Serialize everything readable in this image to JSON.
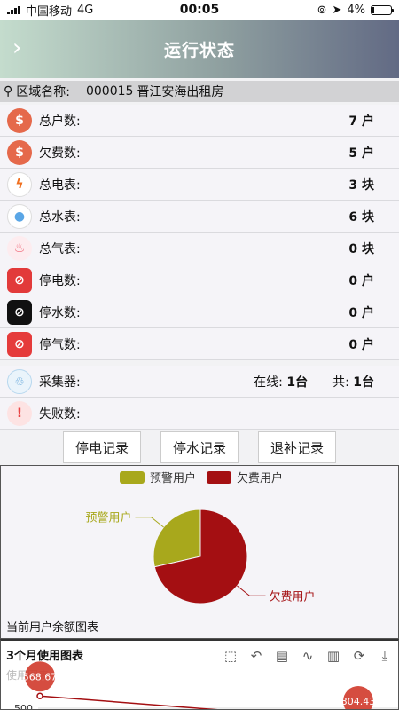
{
  "status": {
    "carrier": "中国移动",
    "network": "4G",
    "time": "00:05",
    "battery": "4%"
  },
  "nav": {
    "title": "运行状态",
    "back": "›"
  },
  "area": {
    "label": "区域名称:",
    "code": "000015",
    "name": "晋江安海出租房"
  },
  "stats": [
    {
      "label": "总户数:",
      "value": "7 户",
      "icon": "money-bag-icon"
    },
    {
      "label": "欠费数:",
      "value": "5 户",
      "icon": "money-bag-icon"
    },
    {
      "label": "总电表:",
      "value": "3 块",
      "icon": "bolt-icon"
    },
    {
      "label": "总水表:",
      "value": "6 块",
      "icon": "water-drop-icon"
    },
    {
      "label": "总气表:",
      "value": "0 块",
      "icon": "flame-icon"
    },
    {
      "label": "停电数:",
      "value": "0 户",
      "icon": "power-off-icon"
    },
    {
      "label": "停水数:",
      "value": "0 户",
      "icon": "water-off-icon"
    },
    {
      "label": "停气数:",
      "value": "0 户",
      "icon": "gas-off-icon"
    }
  ],
  "collector": {
    "label": "采集器:",
    "online_label": "在线:",
    "online": "1台",
    "total_label": "共:",
    "total": "1台"
  },
  "failure": {
    "label": "失败数:"
  },
  "buttons": {
    "outage": "停电记录",
    "water": "停水记录",
    "refund": "退补记录"
  },
  "pie": {
    "caption": "当前用户余额图表",
    "legend": [
      {
        "name": "预警用户",
        "color": "#a8a81c"
      },
      {
        "name": "欠费用户",
        "color": "#a40f12"
      }
    ]
  },
  "usage": {
    "title": "3个月使用图表",
    "subtitle": "使用图表",
    "y_tick": "500",
    "labels": [
      "568.67",
      "304.43"
    ]
  },
  "chart_data": [
    {
      "type": "pie",
      "title": "当前用户余额图表",
      "categories": [
        "预警用户",
        "欠费用户"
      ],
      "values": [
        2,
        5
      ],
      "colors": [
        "#a8a81c",
        "#a40f12"
      ],
      "legend": "top"
    },
    {
      "type": "line",
      "title": "3个月使用图表",
      "subtitle": "使用图表",
      "series": [
        {
          "name": "",
          "values": [
            568.67,
            304.43
          ]
        }
      ],
      "yticks": [
        500
      ]
    }
  ]
}
